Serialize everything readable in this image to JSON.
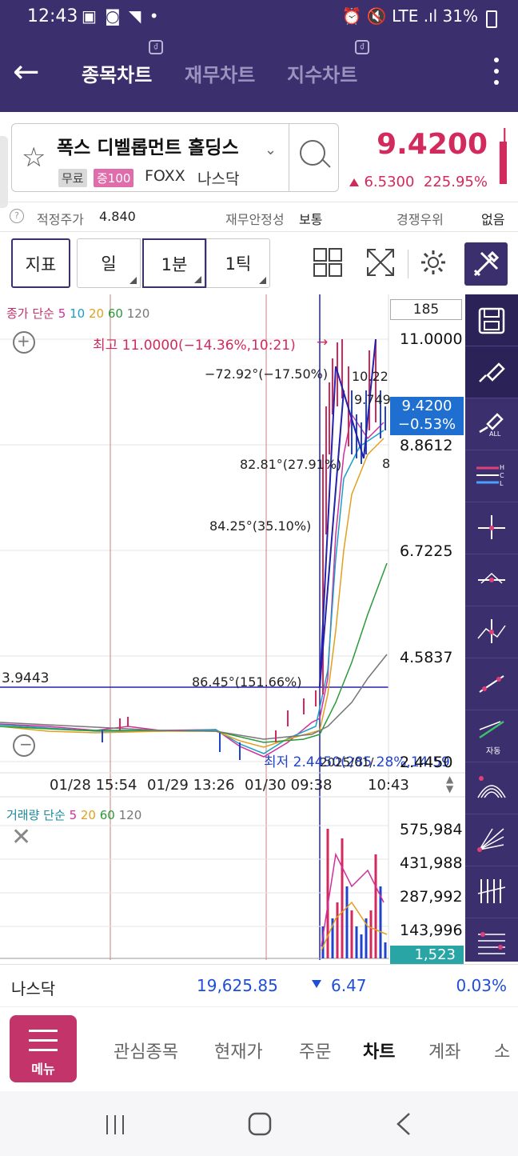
{
  "status": {
    "time": "12:43",
    "icons": "▣ ◙ ◥ •",
    "right": "⏰ 🔇 LTE .ıl 31%"
  },
  "header": {
    "tabs": [
      {
        "label": "종목차트",
        "active": true
      },
      {
        "label": "재무차트",
        "active": false
      },
      {
        "label": "지수차트",
        "active": false
      }
    ]
  },
  "stock": {
    "name": "폭스 디벨롭먼트 홀딩스",
    "badge1": "무료",
    "badge2": "증100",
    "ticker": "FOXX",
    "market": "나스닥",
    "price": "9.4200",
    "change": "6.5300",
    "change_pct": "225.95%"
  },
  "info": {
    "fair_label": "적정주가",
    "fair_value": "4.840",
    "finance_label": "재무안정성",
    "finance_value": "보통",
    "comp_label": "경쟁우위",
    "comp_value": "없음"
  },
  "toolbar": {
    "indicator": "지표",
    "day": "일",
    "min": "1분",
    "tick": "1틱"
  },
  "chart": {
    "legend_price": {
      "label": "종가 단순",
      "p5": "5",
      "p10": "10",
      "p20": "20",
      "p60": "60",
      "p120": "120"
    },
    "period_box": "185",
    "high_label": "최고 11.0000(−14.36%,10:21)",
    "low_label": "최저 2.4450(285.28%,14:59",
    "date_label": "2025/01/",
    "ann1": "−72.92°(−17.50%)",
    "ann2": "82.81°(27.91%)",
    "ann3": "84.25°(35.10%)",
    "ann4": "86.45°(151.66%)",
    "trend_labels": [
      "10.22",
      "9.749",
      "8"
    ],
    "hline_value": "3.9443",
    "y_labels": [
      "11.0000",
      "8.8612",
      "6.7225",
      "4.5837",
      "2.4450"
    ],
    "current_price": "9.4200",
    "current_pct": "−0.53%",
    "x_labels": [
      "01/28 15:54",
      "01/29 13:26",
      "01/30 09:38",
      "10:43"
    ],
    "legend_vol": {
      "label": "거래량 단순",
      "p5": "5",
      "p20": "20",
      "p60": "60",
      "p120": "120"
    },
    "vol_labels": [
      "575,984",
      "431,988",
      "287,992",
      "143,996"
    ],
    "vol_current": "1,523"
  },
  "chart_data": {
    "type": "line",
    "price_axis": [
      2.445,
      11.0
    ],
    "price_ticks": [
      11.0,
      8.8612,
      6.7225,
      4.5837,
      2.445
    ],
    "volume_axis": [
      0,
      575984
    ],
    "volume_ticks": [
      575984,
      431988,
      287992,
      143996
    ],
    "current_price": 9.42,
    "reference_line": 3.9443,
    "high": 11.0,
    "low": 2.445
  },
  "right_tools": {
    "tool7_label": "자동"
  },
  "nasdaq": {
    "label": "나스닥",
    "value": "19,625.85",
    "change": "6.47",
    "pct": "0.03%"
  },
  "nav": {
    "menu": "메뉴",
    "items": [
      "관심종목",
      "현재가",
      "주문",
      "차트",
      "계좌",
      "소"
    ]
  },
  "colors": {
    "primary": "#3b2f6e",
    "up": "#d22a5c",
    "down": "#1f4fd6",
    "ma5": "#d0309a",
    "ma10": "#1aa0c8",
    "ma20": "#e0a020",
    "ma60": "#2a9a3a",
    "ma120": "#777777"
  }
}
